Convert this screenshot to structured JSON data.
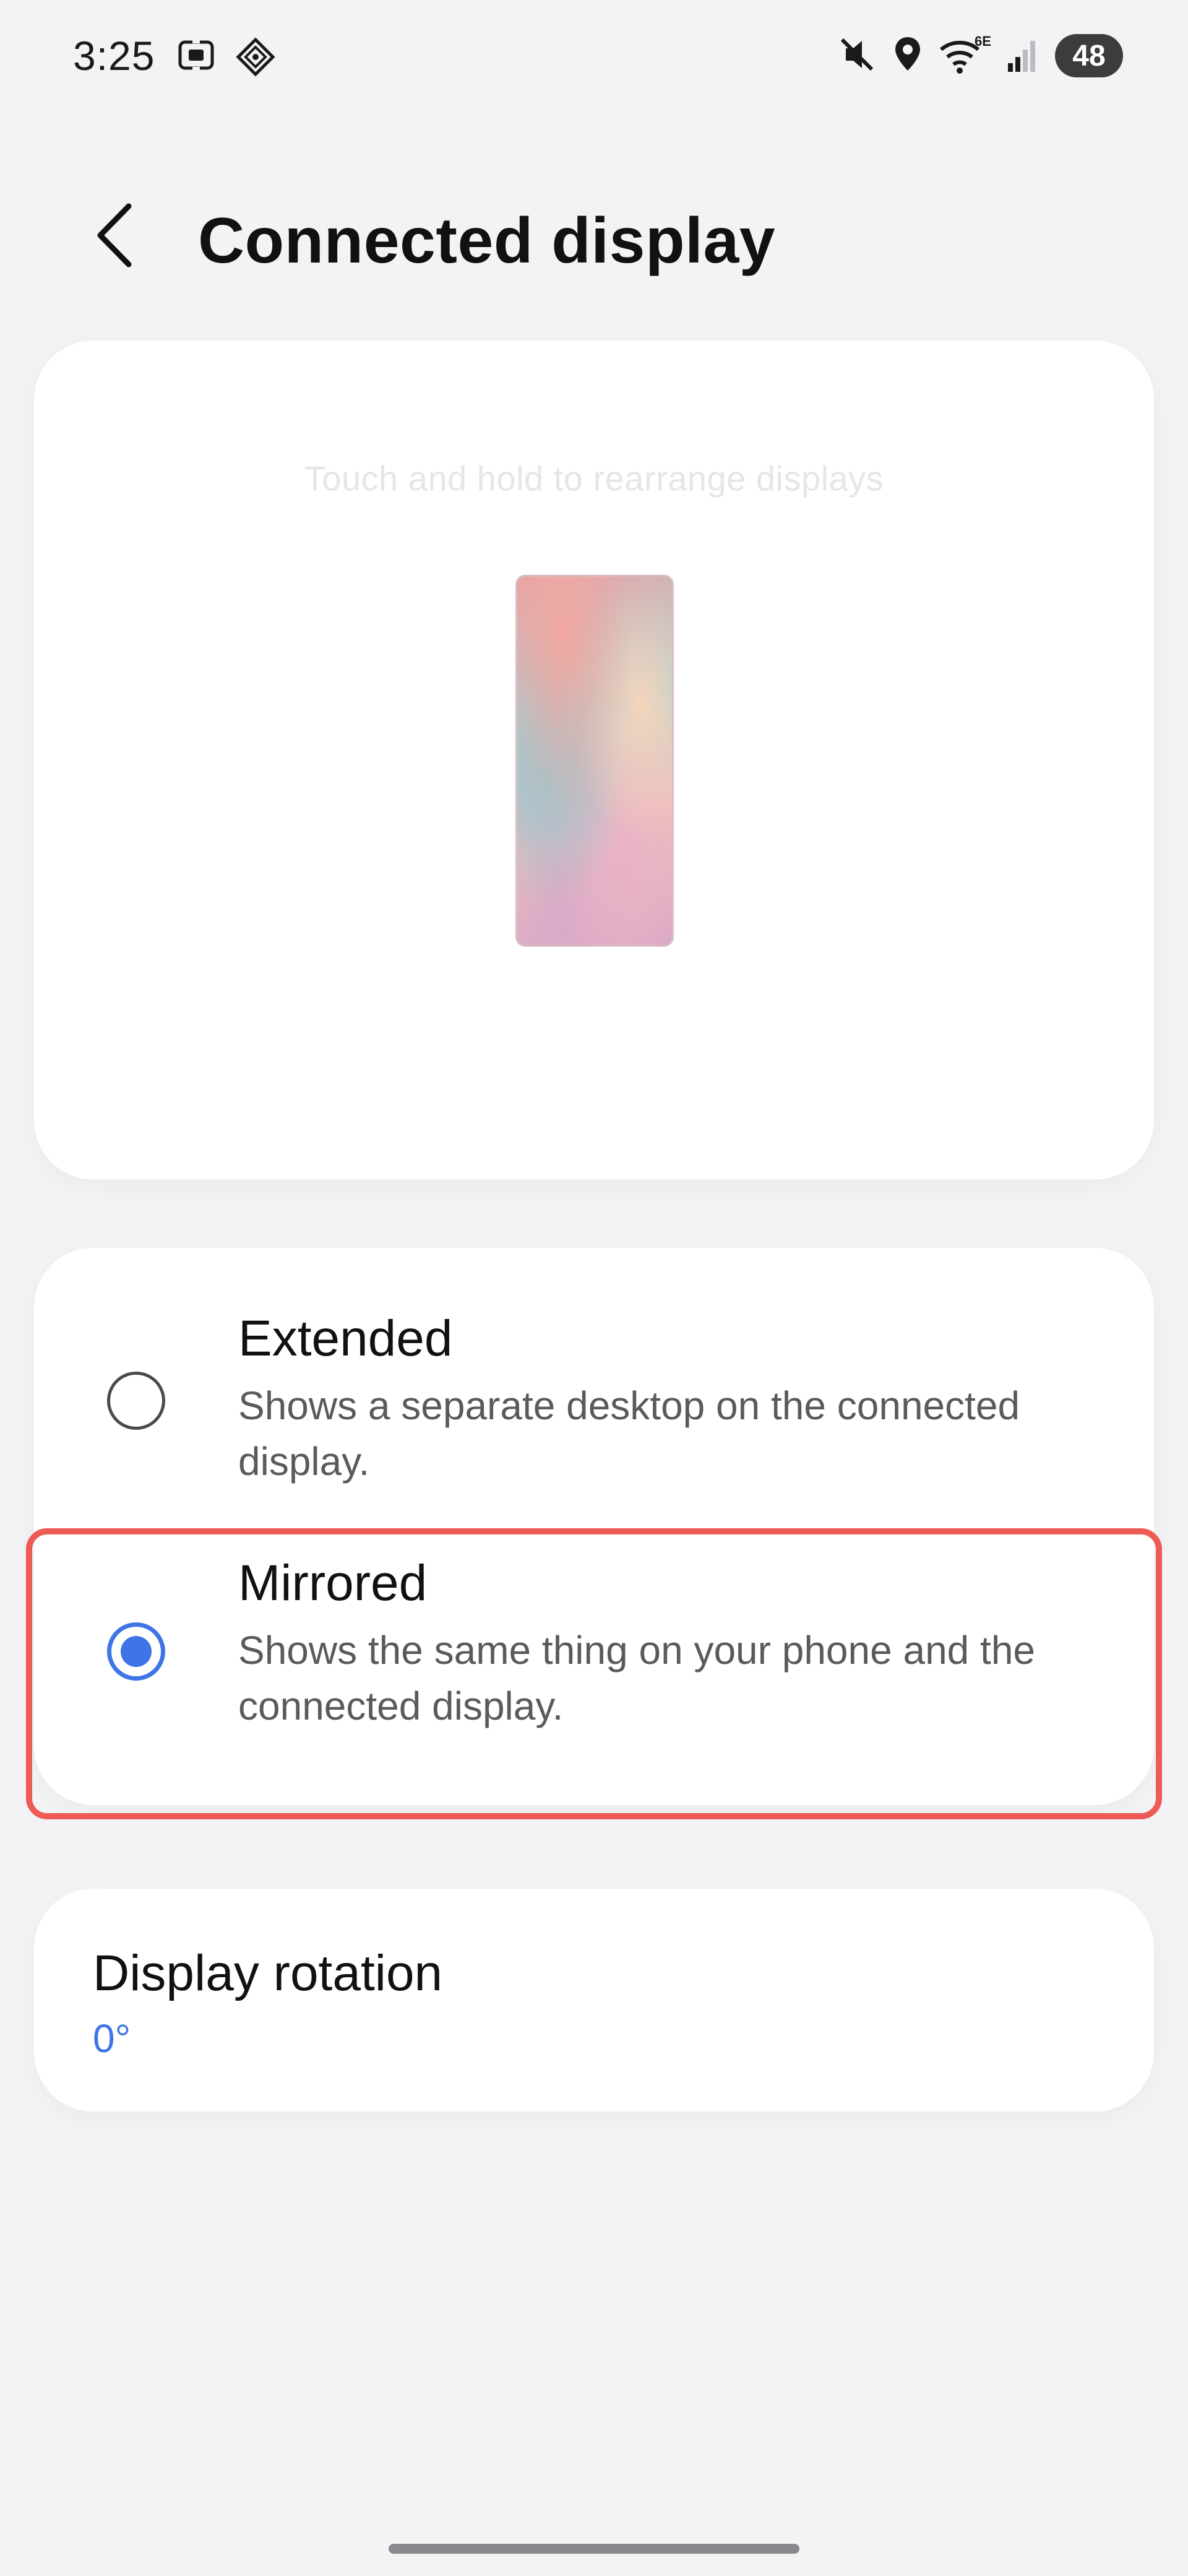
{
  "status_bar": {
    "time": "3:25",
    "left_icons": [
      "screenshot-icon",
      "navigation-icon"
    ],
    "right_icons": [
      "mute-icon",
      "location-icon",
      "wifi-6e-icon",
      "signal-icon"
    ],
    "battery": "48"
  },
  "header": {
    "title": "Connected display",
    "back_icon": "back-chevron-icon"
  },
  "preview": {
    "hint": "Touch and hold to rearrange displays"
  },
  "modes": {
    "selected": "mirrored",
    "extended": {
      "title": "Extended",
      "description": "Shows a separate desktop on the connected display."
    },
    "mirrored": {
      "title": "Mirrored",
      "description": "Shows the same thing on your phone and the connected display."
    }
  },
  "rotation": {
    "title": "Display rotation",
    "value": "0°"
  },
  "colors": {
    "accent": "#3e74e6",
    "highlight": "#ee5a55",
    "background": "#f3f3f6"
  }
}
